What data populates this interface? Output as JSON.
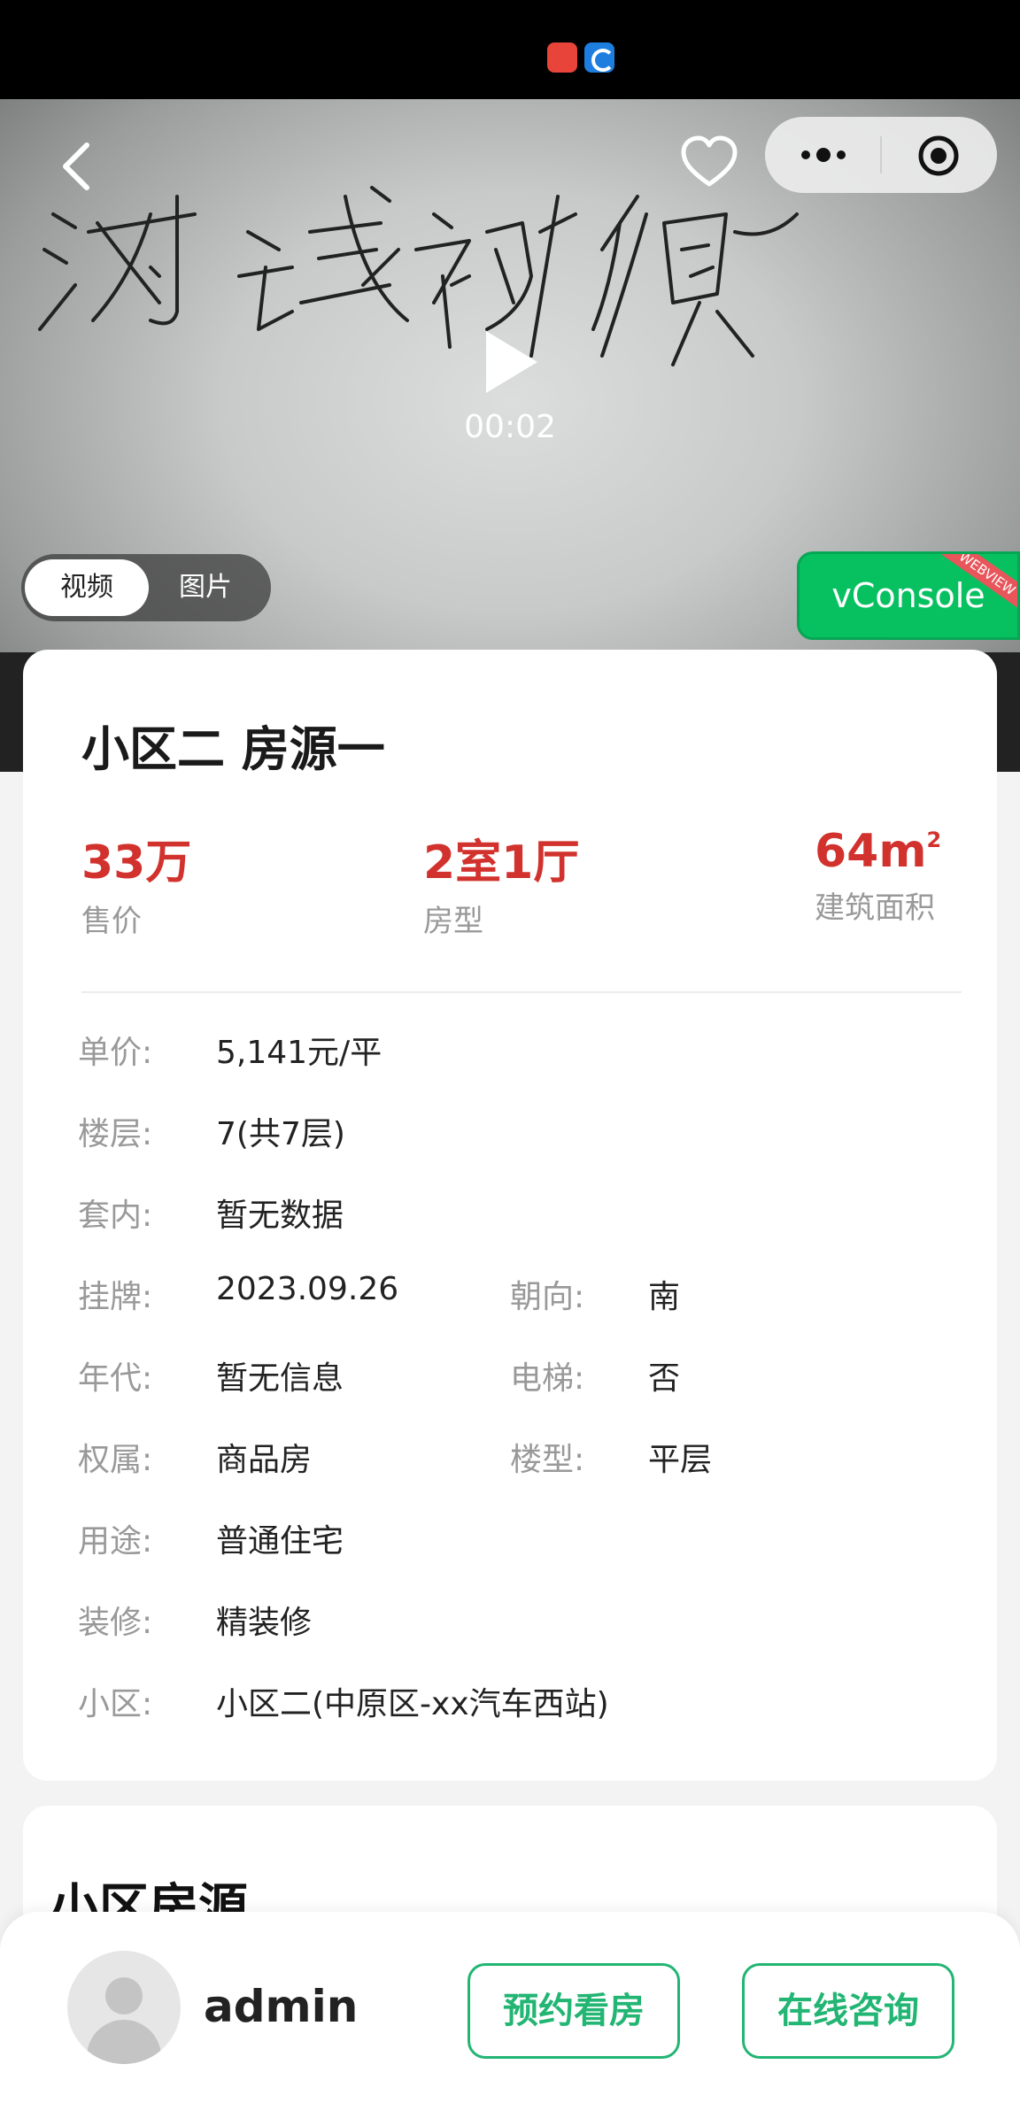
{
  "video": {
    "time": "00:02",
    "toggle": {
      "active": "视频",
      "inactive": "图片"
    },
    "vconsole": {
      "label": "vConsole",
      "ribbon": "WEBVIEW"
    }
  },
  "listing": {
    "title": "小区二 房源一",
    "stats": [
      {
        "value": "33万",
        "label": "售价"
      },
      {
        "value": "2室1厅",
        "label": "房型"
      },
      {
        "value": "64m",
        "sup": "2",
        "label": "建筑面积"
      }
    ],
    "details": [
      {
        "k": "单价:",
        "v": "5,141元/平"
      },
      {
        "k": "楼层:",
        "v": "7(共7层)"
      },
      {
        "k": "套内:",
        "v": "暂无数据"
      },
      {
        "k": "挂牌:",
        "v": "2023.09.26",
        "k2": "朝向:",
        "v2": "南"
      },
      {
        "k": "年代:",
        "v": "暂无信息",
        "k2": "电梯:",
        "v2": "否"
      },
      {
        "k": "权属:",
        "v": "商品房",
        "k2": "楼型:",
        "v2": "平层"
      },
      {
        "k": "用途:",
        "v": "普通住宅"
      },
      {
        "k": "装修:",
        "v": "精装修"
      },
      {
        "k": "小区:",
        "v": "小区二(中原区-xx汽车西站)"
      }
    ]
  },
  "community_section": {
    "title": "小区房源"
  },
  "bottom_bar": {
    "username": "admin",
    "book_label": "预约看房",
    "consult_label": "在线咨询"
  },
  "colors": {
    "accent_red": "#d2322d",
    "accent_green": "#22b573",
    "vconsole_green": "#07c160"
  }
}
